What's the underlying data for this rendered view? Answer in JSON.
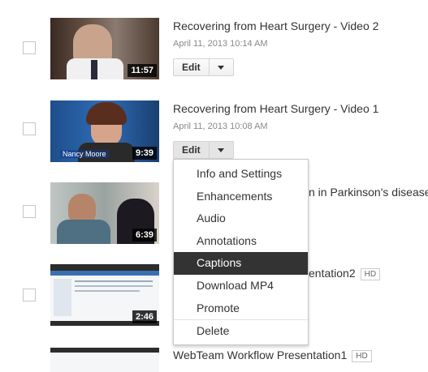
{
  "videos": [
    {
      "title": "Recovering from Heart Surgery - Video 2",
      "date": "April 11, 2013 10:14 AM",
      "duration": "11:57",
      "edit_label": "Edit"
    },
    {
      "title": "Recovering from Heart Surgery - Video 1",
      "date": "April 11, 2013 10:08 AM",
      "duration": "9:39",
      "nametag": "Nancy Moore",
      "edit_label": "Edit"
    },
    {
      "title": "n in Parkinson's disease",
      "duration": "6:39"
    },
    {
      "title": "entation2",
      "badge": "HD",
      "duration": "2:46"
    },
    {
      "title": "WebTeam Workflow Presentation1",
      "badge": "HD"
    }
  ],
  "menu": {
    "items": [
      "Info and Settings",
      "Enhancements",
      "Audio",
      "Annotations",
      "Captions",
      "Download MP4",
      "Promote",
      "Delete"
    ],
    "active_index": 4
  },
  "colors": {
    "menu_active_bg": "#333333",
    "row_border": "#e8e8e8"
  }
}
